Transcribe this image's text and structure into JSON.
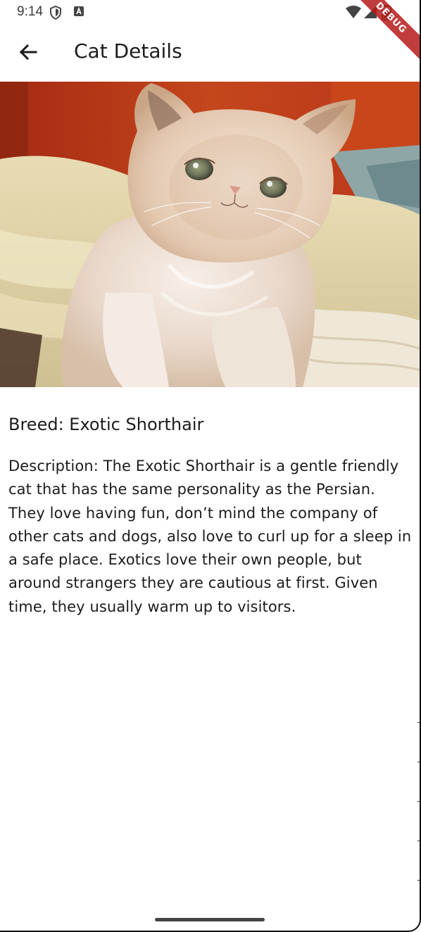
{
  "status_bar": {
    "time": "9:14",
    "icons": [
      "shield-icon",
      "a-icon",
      "wifi-icon",
      "signal-icon",
      "battery-icon"
    ]
  },
  "debug_banner": {
    "label": "DEBUG"
  },
  "app_bar": {
    "back_icon": "arrow-left-icon",
    "title": "Cat Details"
  },
  "hero_image": {
    "subject": "cream exotic shorthair kitten"
  },
  "details": {
    "breed_text": "Breed: Exotic Shorthair",
    "description_text": "Description: The Exotic Shorthair is a gentle friendly cat that has the same personality as the Persian. They love having fun, don’t mind the company of other cats and dogs, also love to curl up for a sleep in a safe place. Exotics love their own people, but around strangers they are cautious at first. Given time, they usually warm up to visitors."
  },
  "colors": {
    "banner": "#b71c1c",
    "text": "#1c1b1f",
    "background": "#ffffff"
  }
}
